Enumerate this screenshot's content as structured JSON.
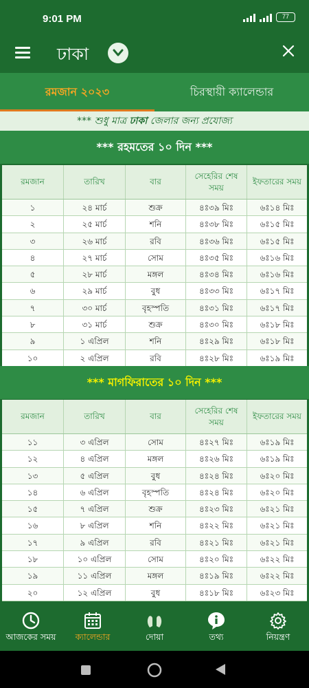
{
  "status": {
    "time": "9:01 PM",
    "battery": "77"
  },
  "header": {
    "city": "ঢাকা"
  },
  "tabs": [
    {
      "label": "রমজান ২০২৩"
    },
    {
      "label": "চিরস্থায়ী ক্যালেন্ডার"
    }
  ],
  "note": {
    "prefix": "*** শুধু মাত্র ",
    "city": "ঢাকা",
    "suffix": " জেলার জন্য প্রযোজ্য"
  },
  "table_headers": [
    "রমজান",
    "তারিখ",
    "বার",
    "সেহেরির শেষ সময়",
    "ইফতারের সময়"
  ],
  "section1": {
    "title": "***  রহমতের ১০ দিন  ***",
    "rows": [
      [
        "১",
        "২৪ মার্চ",
        "শুক্র",
        "৪ঃ৩৯ মিঃ",
        "৬ঃ১৪ মিঃ"
      ],
      [
        "২",
        "২৫ মার্চ",
        "শনি",
        "৪ঃ৩৮ মিঃ",
        "৬ঃ১৫ মিঃ"
      ],
      [
        "৩",
        "২৬ মার্চ",
        "রবি",
        "৪ঃ৩৬ মিঃ",
        "৬ঃ১৫ মিঃ"
      ],
      [
        "৪",
        "২৭ মার্চ",
        "সোম",
        "৪ঃ৩৫ মিঃ",
        "৬ঃ১৬ মিঃ"
      ],
      [
        "৫",
        "২৮ মার্চ",
        "মঙ্গল",
        "৪ঃ৩৪ মিঃ",
        "৬ঃ১৬ মিঃ"
      ],
      [
        "৬",
        "২৯ মার্চ",
        "বুধ",
        "৪ঃ৩৩ মিঃ",
        "৬ঃ১৭ মিঃ"
      ],
      [
        "৭",
        "৩০ মার্চ",
        "বৃহস্পতি",
        "৪ঃ৩১ মিঃ",
        "৬ঃ১৭ মিঃ"
      ],
      [
        "৮",
        "৩১ মার্চ",
        "শুক্র",
        "৪ঃ৩০ মিঃ",
        "৬ঃ১৮ মিঃ"
      ],
      [
        "৯",
        "১ এপ্রিল",
        "শনি",
        "৪ঃ২৯ মিঃ",
        "৬ঃ১৮ মিঃ"
      ],
      [
        "১০",
        "২ এপ্রিল",
        "রবি",
        "৪ঃ২৮ মিঃ",
        "৬ঃ১৯ মিঃ"
      ]
    ]
  },
  "section2": {
    "title": "***  মাগফিরাতের ১০ দিন  ***",
    "rows": [
      [
        "১১",
        "৩ এপ্রিল",
        "সোম",
        "৪ঃ২৭ মিঃ",
        "৬ঃ১৯ মিঃ"
      ],
      [
        "১২",
        "৪ এপ্রিল",
        "মঙ্গল",
        "৪ঃ২৬ মিঃ",
        "৬ঃ১৯ মিঃ"
      ],
      [
        "১৩",
        "৫ এপ্রিল",
        "বুধ",
        "৪ঃ২৪ মিঃ",
        "৬ঃ২০ মিঃ"
      ],
      [
        "১৪",
        "৬ এপ্রিল",
        "বৃহস্পতি",
        "৪ঃ২৪ মিঃ",
        "৬ঃ২০ মিঃ"
      ],
      [
        "১৫",
        "৭ এপ্রিল",
        "শুক্র",
        "৪ঃ২৩ মিঃ",
        "৬ঃ২১ মিঃ"
      ],
      [
        "১৬",
        "৮ এপ্রিল",
        "শনি",
        "৪ঃ২২ মিঃ",
        "৬ঃ২১ মিঃ"
      ],
      [
        "১৭",
        "৯ এপ্রিল",
        "রবি",
        "৪ঃ২১ মিঃ",
        "৬ঃ২১ মিঃ"
      ],
      [
        "১৮",
        "১০ এপ্রিল",
        "সোম",
        "৪ঃ২০ মিঃ",
        "৬ঃ২২ মিঃ"
      ],
      [
        "১৯",
        "১১ এপ্রিল",
        "মঙ্গল",
        "৪ঃ১৯ মিঃ",
        "৬ঃ২২ মিঃ"
      ],
      [
        "২০",
        "১২ এপ্রিল",
        "বুধ",
        "৪ঃ১৮ মিঃ",
        "৬ঃ২৩ মিঃ"
      ]
    ]
  },
  "bottom_nav": [
    {
      "label": "আজকের সময়",
      "icon": "clock-icon"
    },
    {
      "label": "ক্যালেন্ডার",
      "icon": "calendar-icon"
    },
    {
      "label": "দোয়া",
      "icon": "praying-hands-icon"
    },
    {
      "label": "তথ্য",
      "icon": "info-icon"
    },
    {
      "label": "নিয়ন্ত্রণ",
      "icon": "gear-icon"
    }
  ],
  "colors": {
    "primary": "#1d6b2f",
    "accent": "#f5a623",
    "section_yellow": "#f3f000"
  }
}
